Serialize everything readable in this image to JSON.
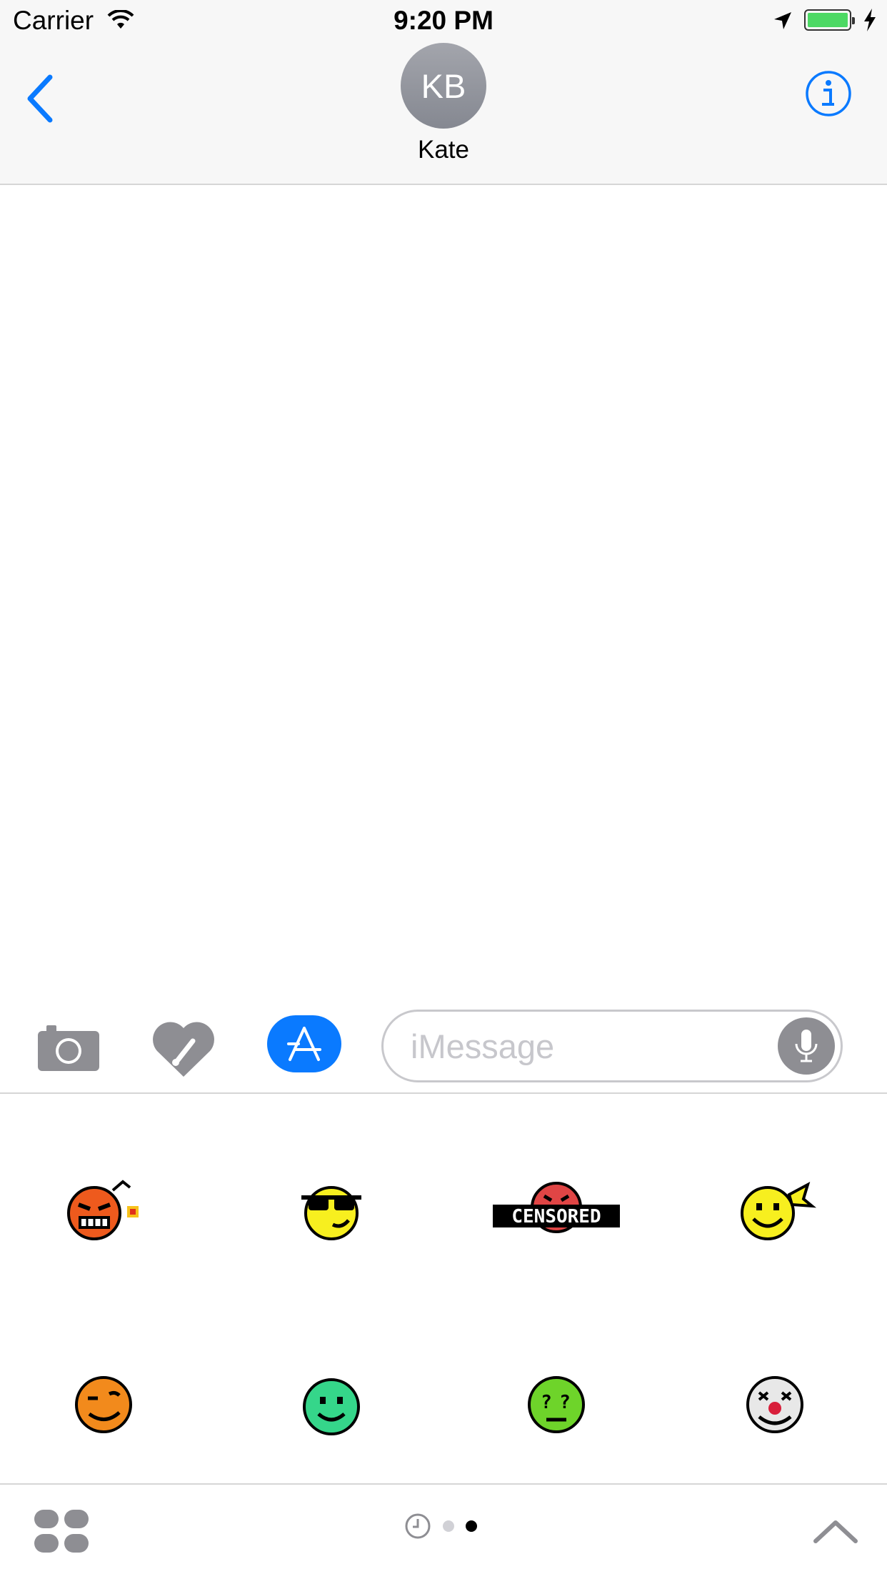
{
  "status_bar": {
    "carrier": "Carrier",
    "time": "9:20 PM",
    "wifi_icon": "wifi-icon",
    "location_icon": "location-arrow-icon",
    "battery_icon": "battery-icon",
    "charging_icon": "charging-bolt-icon",
    "battery_color": "#4cd964"
  },
  "nav": {
    "back_icon": "chevron-left-icon",
    "avatar_initials": "KB",
    "contact_name": "Kate",
    "info_icon": "info-icon",
    "accent_color": "#0a7aff"
  },
  "compose": {
    "camera_icon": "camera-icon",
    "digital_touch_icon": "heart-digital-touch-icon",
    "app_store_icon": "app-store-icon",
    "message_placeholder": "iMessage",
    "message_value": "",
    "mic_icon": "microphone-icon"
  },
  "stickers": {
    "items": [
      {
        "name": "angry-bomb-face-sticker",
        "color": "#ee5a1d"
      },
      {
        "name": "cool-sunglasses-face-sticker",
        "color": "#f7ef1f"
      },
      {
        "name": "censored-face-sticker",
        "color": "#e04545",
        "label": "CENSORED"
      },
      {
        "name": "smiley-with-bow-sticker",
        "color": "#f7ef1f"
      },
      {
        "name": "winking-orange-face-sticker",
        "color": "#f28a1c"
      },
      {
        "name": "green-smiley-sticker",
        "color": "#35d68a"
      },
      {
        "name": "confused-green-face-sticker",
        "color": "#6ed42a"
      },
      {
        "name": "clown-face-sticker",
        "color": "#e8e8e8"
      }
    ]
  },
  "bottom_bar": {
    "app_drawer_icon": "app-grid-icon",
    "recents_icon": "clock-icon",
    "page_count": 2,
    "active_page": 2,
    "expand_icon": "chevron-up-icon"
  }
}
